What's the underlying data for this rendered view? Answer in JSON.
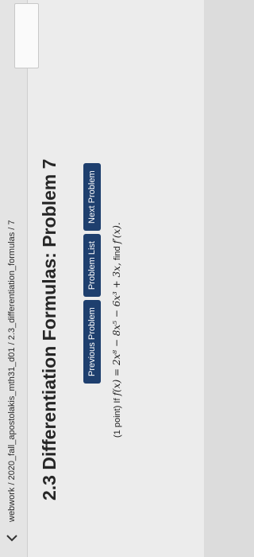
{
  "header": {
    "breadcrumb": "webwork / 2020_fall_apostolakis_mth31_d01 / 2.3_differentiation_formulas / 7"
  },
  "page": {
    "title": "2.3 Differentiation Formulas: Problem 7"
  },
  "nav_buttons": {
    "previous_label": "Previous Problem",
    "list_label": "Problem List",
    "next_label": "Next Problem"
  },
  "problem": {
    "points": "(1 point) If",
    "function": "f(x) = 2x⁸ − 8x⁵ − 6x³ + 3x,",
    "find_text": "find",
    "target": "f′(x)."
  },
  "colors": {
    "button_bg": "#1e3f6e",
    "background": "#ececec"
  }
}
